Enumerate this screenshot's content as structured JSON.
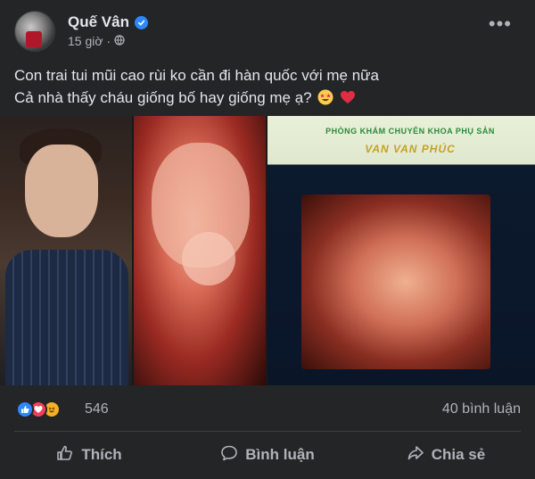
{
  "post": {
    "author": "Quế Vân",
    "time": "15 giờ",
    "caption_line1": "Con trai tui mũi cao rùi ko cần đi hàn quốc với mẹ nữa",
    "caption_line2": "Cả nhà thấy cháu giống bố hay giống mẹ ạ?",
    "caption_emojis": [
      "star-struck-emoji",
      "red-heart-emoji"
    ],
    "clinic_sign_line1": "PHÒNG KHÁM CHUYÊN KHOA PHỤ SẢN",
    "clinic_sign_line2": "VAN VAN PHÚC"
  },
  "stats": {
    "reaction_icons": [
      "like-icon",
      "love-icon",
      "haha-icon"
    ],
    "reaction_count": "546",
    "comment_count": "40 bình luận"
  },
  "actions": {
    "like": "Thích",
    "comment": "Bình luận",
    "share": "Chia sẻ"
  },
  "colors": {
    "background": "#242526",
    "accent_blue": "#2d88ff",
    "love_red": "#f33e58",
    "haha_yellow": "#f7b125"
  }
}
